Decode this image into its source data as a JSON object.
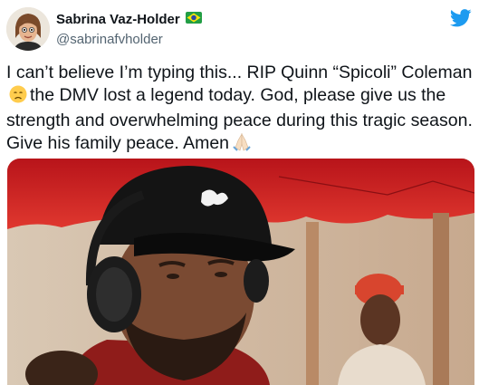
{
  "author": {
    "name": "Sabrina Vaz-Holder",
    "handle": "@sabrinafvholder",
    "flag_icon": "brazil-flag-icon"
  },
  "platform_icon": "twitter-bird-icon",
  "tweet": {
    "line1": "I can’t believe I’m typing this... RIP Quinn “Spicoli” Coleman",
    "line2": "the DMV lost a legend today. God, please give us the",
    "line3": "strength and overwhelming peace during this tragic season.",
    "line4": "Give his family peace. Amen",
    "emoji_sad": "sad-face-emoji",
    "emoji_pray": "praying-hands-emoji"
  },
  "media": {
    "description_icon": "photo-dj-headphones"
  },
  "colors": {
    "twitter_blue": "#1d9bf0",
    "text": "#0f1419",
    "secondary": "#536471"
  }
}
